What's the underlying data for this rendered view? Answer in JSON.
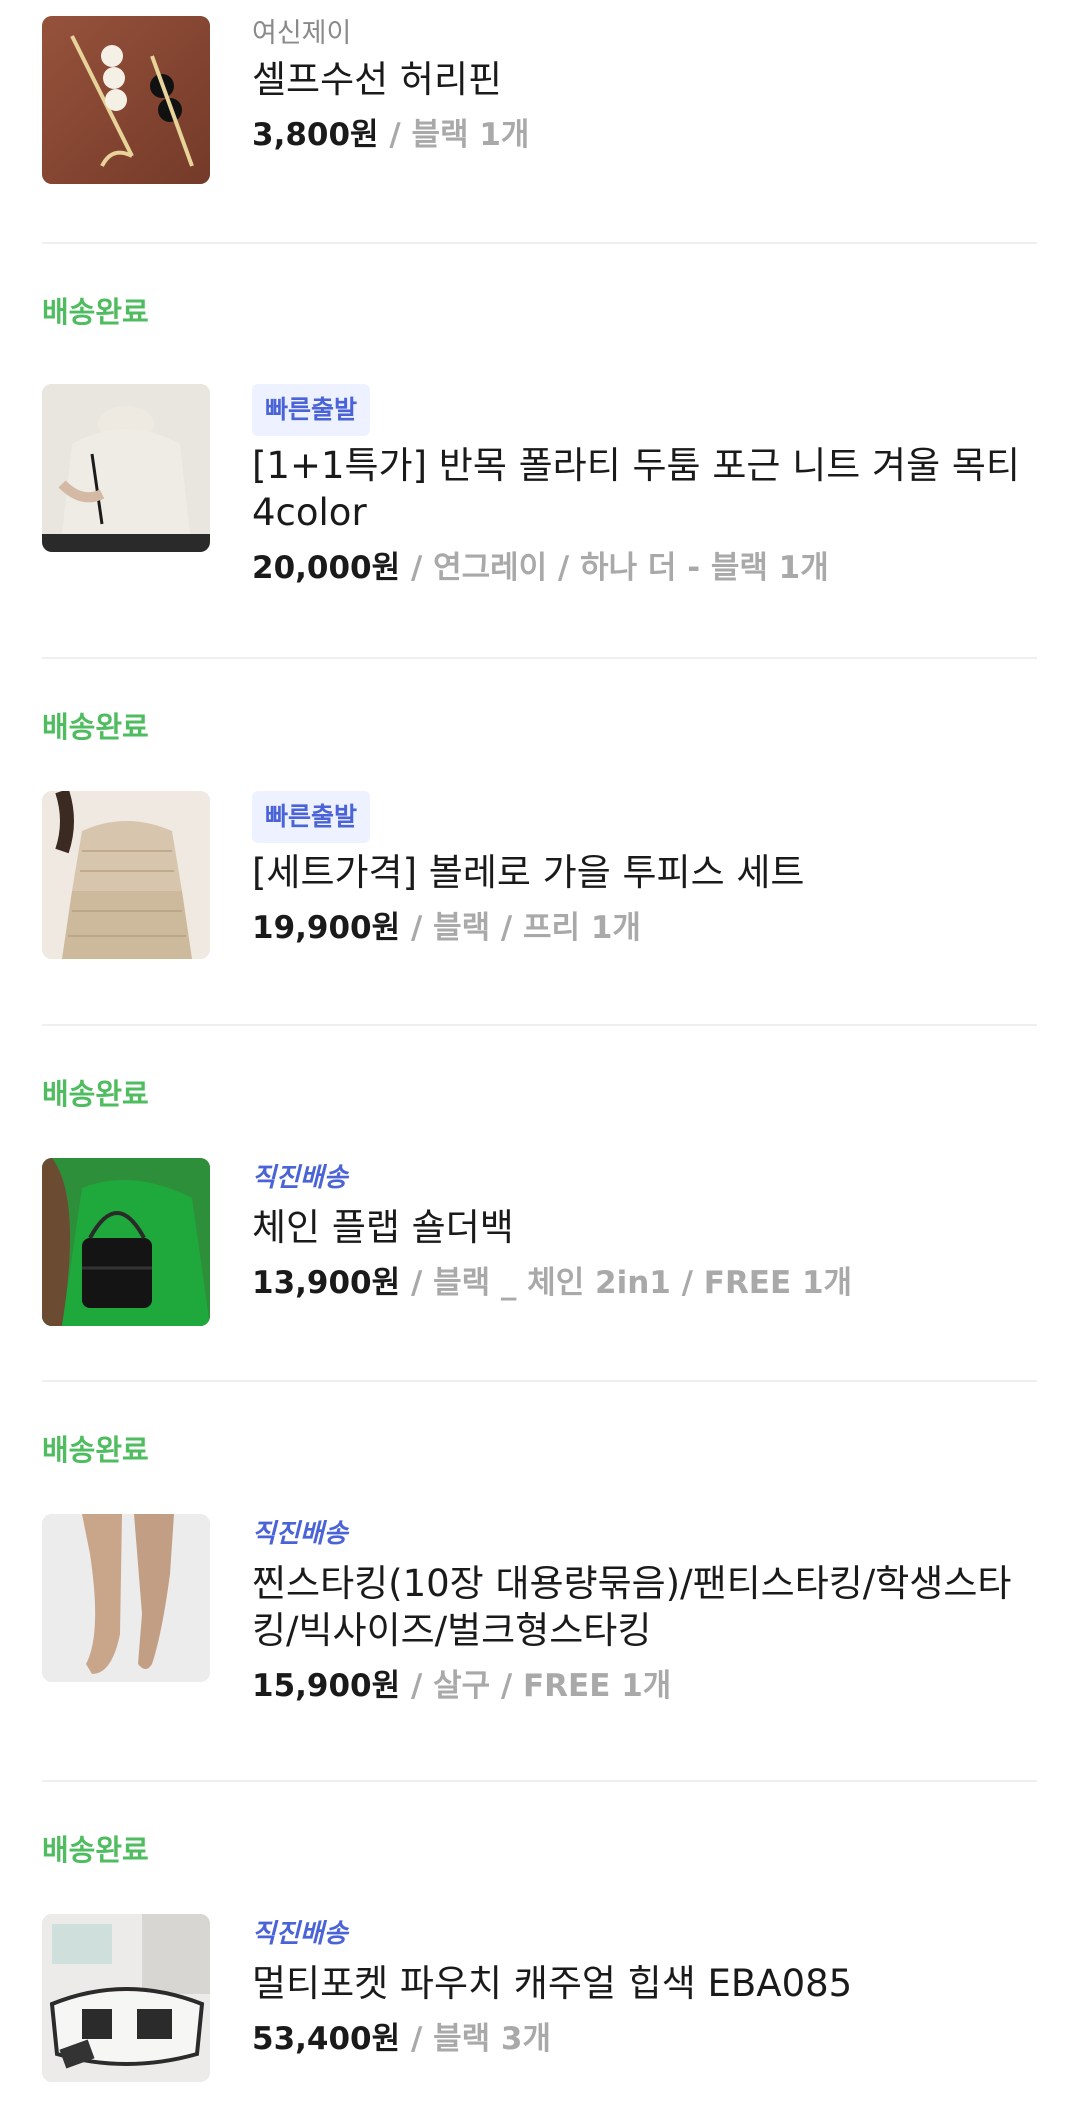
{
  "orders": [
    {
      "status": "",
      "shop": "여신제이",
      "badge": "",
      "title": "셀프수선 허리핀",
      "price": "3,800원",
      "options": " / 블랙 1개",
      "thumb_icon": "pearl-safety-pin-image"
    },
    {
      "status": "배송완료",
      "badge": "빠른출발",
      "title": "[1+1특가] 반목 폴라티 두툼 포근 니트 겨울 목티 4color",
      "price": "20,000원",
      "options": " / 연그레이 / 하나 더 - 블랙 1개",
      "thumb_icon": "knit-sweater-image"
    },
    {
      "status": "배송완료",
      "badge": "빠른출발",
      "title": "[세트가격] 볼레로 가을 투피스 세트",
      "price": "19,900원",
      "options": " / 블랙 / 프리 1개",
      "thumb_icon": "bolero-set-image"
    },
    {
      "status": "배송완료",
      "badge": "직진배송",
      "title": "체인 플랩 숄더백",
      "price": "13,900원",
      "options": " / 블랙 _ 체인 2in1 / FREE 1개",
      "thumb_icon": "shoulder-bag-image"
    },
    {
      "status": "배송완료",
      "badge": "직진배송",
      "title": "찐스타킹(10장 대용량묶음)/팬티스타킹/학생스타킹/빅사이즈/벌크형스타킹",
      "price": "15,900원",
      "options": " / 살구 / FREE 1개",
      "thumb_icon": "stockings-image"
    },
    {
      "status": "배송완료",
      "badge": "직진배송",
      "title": "멀티포켓 파우치 캐주얼 힙색 EBA085",
      "price": "53,400원",
      "options": " / 블랙 3개",
      "thumb_icon": "hip-sack-image"
    }
  ],
  "colors": {
    "status": "#4fbd5f",
    "badge": "#4a63d6",
    "badge_bg": "#eef1ff",
    "option_text": "#a9a9a9"
  }
}
